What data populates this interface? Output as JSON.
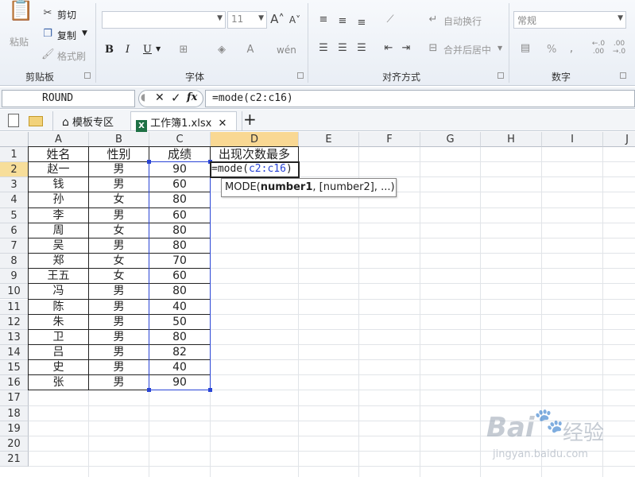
{
  "ribbon": {
    "clipboard": {
      "label": "剪贴板",
      "paste": "粘贴",
      "cut": "剪切",
      "copy": "复制",
      "format_painter": "格式刷"
    },
    "font": {
      "label": "字体",
      "font_size": "11",
      "bold": "B",
      "italic": "I",
      "underline": "U"
    },
    "alignment": {
      "label": "对齐方式",
      "wrap_text": "自动换行",
      "merge_center": "合并后居中"
    },
    "number": {
      "label": "数字",
      "format": "常规",
      "percent": "%"
    }
  },
  "formula_bar": {
    "name_box": "ROUND",
    "cancel": "✕",
    "enter": "✓",
    "fx": "fx",
    "formula": "=mode(c2:c16)"
  },
  "tabs": {
    "templates": "模板专区",
    "file": "工作簿1.xlsx",
    "add": "+"
  },
  "sheet": {
    "columns": [
      "A",
      "B",
      "C",
      "D",
      "E",
      "F",
      "G",
      "H",
      "I",
      "J"
    ],
    "rows": [
      "1",
      "2",
      "3",
      "4",
      "5",
      "6",
      "7",
      "8",
      "9",
      "10",
      "11",
      "12",
      "13",
      "14",
      "15",
      "16",
      "17",
      "18",
      "19",
      "20",
      "21"
    ],
    "header": [
      "姓名",
      "性别",
      "成绩",
      "出现次数最多"
    ],
    "data": [
      [
        "赵一",
        "男",
        "90"
      ],
      [
        "钱",
        "男",
        "60"
      ],
      [
        "孙",
        "女",
        "80"
      ],
      [
        "李",
        "男",
        "60"
      ],
      [
        "周",
        "女",
        "80"
      ],
      [
        "吴",
        "男",
        "80"
      ],
      [
        "郑",
        "女",
        "70"
      ],
      [
        "王五",
        "女",
        "60"
      ],
      [
        "冯",
        "男",
        "80"
      ],
      [
        "陈",
        "男",
        "40"
      ],
      [
        "朱",
        "男",
        "50"
      ],
      [
        "卫",
        "男",
        "80"
      ],
      [
        "吕",
        "男",
        "82"
      ],
      [
        "史",
        "男",
        "40"
      ],
      [
        "张",
        "男",
        "90"
      ]
    ],
    "editing_prefix": "=mode(",
    "editing_ref": "c2:c16",
    "editing_suffix": ")"
  },
  "tooltip": {
    "func": "MODE(",
    "arg1": "number1",
    "rest": ", [number2], ...)"
  },
  "watermark": {
    "brand": "Bai",
    "brand_cn": "经验",
    "site": "jingyan.baidu.com"
  },
  "colors": {
    "selected_header": "#f9d893",
    "range_blue": "#2a45d6",
    "excel_green": "#1e7145"
  }
}
